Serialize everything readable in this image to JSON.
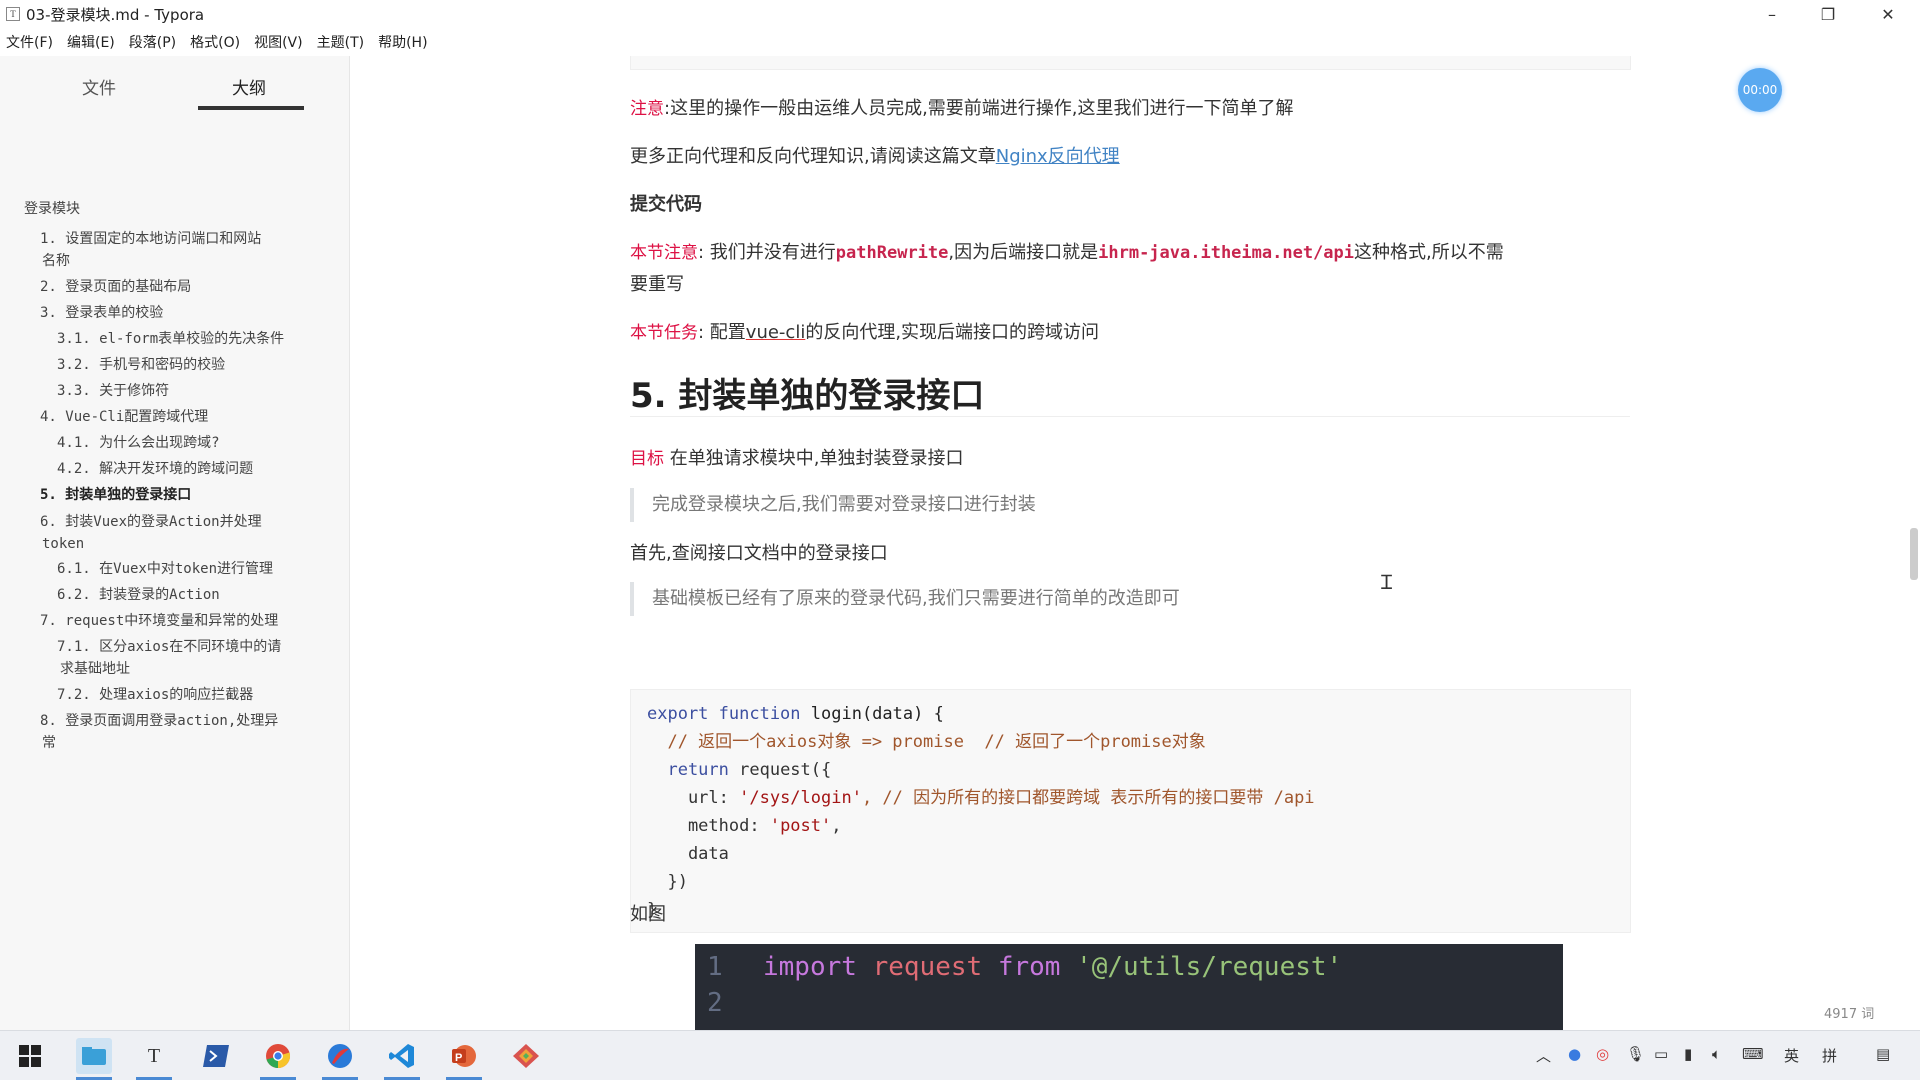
{
  "window": {
    "title": "03-登录模块.md - Typora",
    "app_icon": "T",
    "minimize": "–",
    "maximize": "❐",
    "close": "✕"
  },
  "menu": [
    "文件(F)",
    "编辑(E)",
    "段落(P)",
    "格式(O)",
    "视图(V)",
    "主题(T)",
    "帮助(H)"
  ],
  "sidebar": {
    "tabs": [
      "文件",
      "大纲"
    ],
    "active_tab": "大纲",
    "outline": [
      {
        "text": "登录模块",
        "level": 0
      },
      {
        "text": "1. 设置固定的本地访问端口和网站",
        "level": 1
      },
      {
        "text": "名称",
        "level": 1,
        "cont": true
      },
      {
        "text": "2. 登录页面的基础布局",
        "level": 1
      },
      {
        "text": "3. 登录表单的校验",
        "level": 1
      },
      {
        "text": "3.1. el-form表单校验的先决条件",
        "level": 2
      },
      {
        "text": "3.2. 手机号和密码的校验",
        "level": 2
      },
      {
        "text": "3.3. 关于修饰符",
        "level": 2
      },
      {
        "text": "4. Vue-Cli配置跨域代理",
        "level": 1
      },
      {
        "text": "4.1. 为什么会出现跨域?",
        "level": 2
      },
      {
        "text": "4.2. 解决开发环境的跨域问题",
        "level": 2
      },
      {
        "text": "5. 封装单独的登录接口",
        "level": 1,
        "active": true
      },
      {
        "text": "6. 封装Vuex的登录Action并处理",
        "level": 1
      },
      {
        "text": "token",
        "level": 1,
        "cont": true
      },
      {
        "text": "6.1. 在Vuex中对token进行管理",
        "level": 2
      },
      {
        "text": "6.2. 封装登录的Action",
        "level": 2
      },
      {
        "text": "7. request中环境变量和异常的处理",
        "level": 1
      },
      {
        "text": "7.1. 区分axios在不同环境中的请",
        "level": 2
      },
      {
        "text": "求基础地址",
        "level": 2,
        "cont": true
      },
      {
        "text": "7.2. 处理axios的响应拦截器",
        "level": 2
      },
      {
        "text": "8. 登录页面调用登录action,处理异",
        "level": 1
      },
      {
        "text": "常",
        "level": 1,
        "cont": true
      }
    ],
    "bottom_left": "<",
    "bottom_code": "</>"
  },
  "doc": {
    "note1_label": "注意",
    "note1_text": ":这里的操作一般由运维人员完成,需要前端进行操作,这里我们进行一下简单了解",
    "more_text": "更多正向代理和反向代理知识,请阅读这篇文章",
    "more_link": "Nginx反向代理",
    "submit_heading": "提交代码",
    "note2_label": "本节注意",
    "note2_a": ":  我们并没有进行",
    "note2_code1": "pathRewrite",
    "note2_b": ",因为后端接口就是",
    "note2_code2": "ihrm-java.itheima.net/api",
    "note2_c": "这种格式,所以不需",
    "note2_d": "要重写",
    "task_label": "本节任务",
    "task_a": ":  配置",
    "task_link": "vue-cli",
    "task_b": "的反向代理,实现后端接口的跨域访问",
    "h2": "5. 封装单独的登录接口",
    "goal_label": "目标",
    "goal_text": "在单独请求模块中,单独封装登录接口",
    "quote1": "完成登录模块之后,我们需要对登录接口进行封装",
    "first_text": "首先,查阅接口文档中的登录接口",
    "quote2": "基础模板已经有了原来的登录代码,我们只需要进行简单的改造即可",
    "code": {
      "l1_kw": "export function",
      "l1_fn": " login(data) {",
      "l2": "  // 返回一个axios对象 => promise  // 返回了一个promise对象",
      "l3_kw": "  return",
      "l3_rest": " request({",
      "l4_a": "    url: ",
      "l4_str": "'/sys/login'",
      "l4_cm": ", // 因为所有的接口都要跨域 表示所有的接口要带 /api",
      "l5_a": "    method: ",
      "l5_str": "'post'",
      "l5_b": ",",
      "l6": "    data",
      "l7": "  })",
      "l8": "}"
    },
    "as_fig": "如图",
    "img_ln1": "1",
    "img_ln2": "2",
    "img_kw1": "import",
    "img_name": "request",
    "img_kw2": "from",
    "img_str": "'@/utils/request'"
  },
  "timer": "00:00",
  "word_count": "4917 词",
  "taskbar": {
    "tray_ime1": "英",
    "tray_ime2": "拼"
  }
}
